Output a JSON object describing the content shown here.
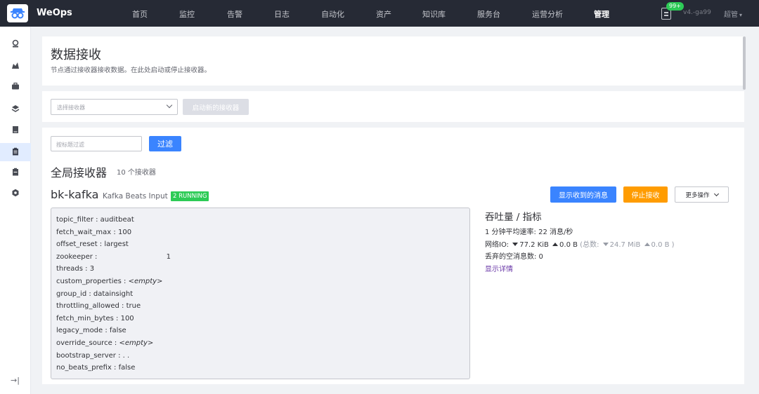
{
  "topbar": {
    "brand": "WeOps",
    "nav": [
      {
        "label": "首页"
      },
      {
        "label": "监控"
      },
      {
        "label": "告警"
      },
      {
        "label": "日志"
      },
      {
        "label": "自动化"
      },
      {
        "label": "资产"
      },
      {
        "label": "知识库"
      },
      {
        "label": "服务台"
      },
      {
        "label": "运营分析"
      },
      {
        "label": "管理",
        "active": true
      }
    ],
    "notifications_badge": "99+",
    "version": "v4.-ga99",
    "user": "超管"
  },
  "sidebar": {
    "icons": [
      "dashboard-icon",
      "monitor-icon",
      "briefcase-icon",
      "layers-icon",
      "book-icon",
      "clipboard-icon",
      "clipboard-check-icon",
      "hexagon-icon"
    ],
    "active_index": 5,
    "collapse_glyph": "→|"
  },
  "header": {
    "title": "数据接收",
    "description": "节点通过接收器接收数据。在此处启动或停止接收器。"
  },
  "launch": {
    "select_placeholder": "选择接收器",
    "launch_button": "启动新的接收器"
  },
  "filter": {
    "placeholder": "按标题过滤",
    "button": "过滤"
  },
  "section": {
    "title": "全局接收器",
    "count": "10 个接收器"
  },
  "receiver": {
    "name": "bk-kafka",
    "type": "Kafka Beats Input",
    "status": "2 RUNNING",
    "actions": {
      "show_messages": "显示收到的消息",
      "stop": "停止接收",
      "more": "更多操作"
    },
    "config": [
      {
        "key": "topic_filter",
        "value": "auditbeat"
      },
      {
        "key": "fetch_wait_max",
        "value": "100"
      },
      {
        "key": "offset_reset",
        "value": "largest"
      },
      {
        "key": "zookeeper",
        "value": "1"
      },
      {
        "key": "threads",
        "value": "3"
      },
      {
        "key": "custom_properties",
        "value": "<empty>"
      },
      {
        "key": "group_id",
        "value": "datainsight"
      },
      {
        "key": "throttling_allowed",
        "value": "true"
      },
      {
        "key": "fetch_min_bytes",
        "value": "100"
      },
      {
        "key": "legacy_mode",
        "value": "false"
      },
      {
        "key": "override_source",
        "value": "<empty>"
      },
      {
        "key": "bootstrap_server",
        "value": ". ."
      },
      {
        "key": "no_beats_prefix",
        "value": "false"
      }
    ],
    "metrics": {
      "title": "吞吐量 / 指标",
      "rate": "1 分钟平均速率: 22 消息/秒",
      "network_label": "网络IO:",
      "network_in": "77.2 KiB",
      "network_out": "0.0 B",
      "total_open": "(总数:",
      "total_in": "24.7 MiB",
      "total_out": "0.0 B )",
      "dropped": "丢弃的空消息数: 0",
      "details_link": "显示详情"
    }
  },
  "colors": {
    "topbar_bg": "#262a35",
    "primary": "#3a84ff",
    "warning": "#ff9c01",
    "success": "#2dcb56"
  }
}
